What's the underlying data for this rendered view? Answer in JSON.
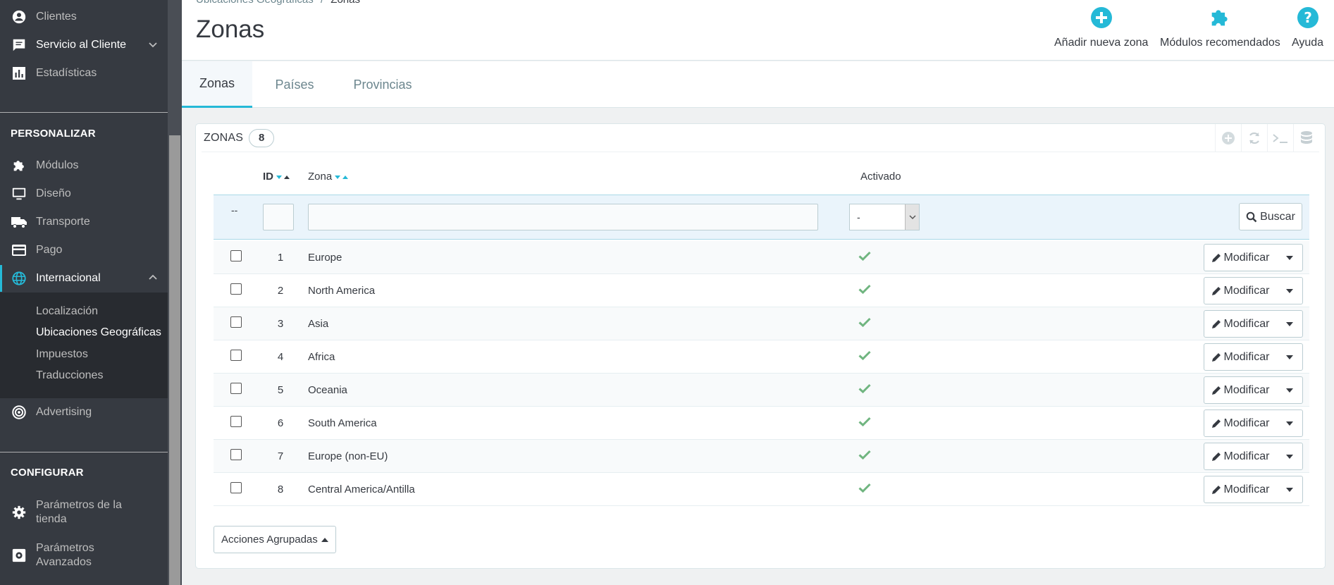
{
  "sidebar": {
    "top_items": [
      {
        "label": "Clientes",
        "icon": "user-icon"
      },
      {
        "label": "Servicio al Cliente",
        "icon": "chat-icon"
      },
      {
        "label": "Estadísticas",
        "icon": "stats-icon"
      }
    ],
    "section_personalizar": "PERSONALIZAR",
    "personalizar_items": [
      {
        "label": "Módulos",
        "icon": "puzzle-icon"
      },
      {
        "label": "Diseño",
        "icon": "monitor-icon"
      },
      {
        "label": "Transporte",
        "icon": "truck-icon"
      },
      {
        "label": "Pago",
        "icon": "card-icon"
      },
      {
        "label": "Internacional",
        "icon": "globe-icon"
      }
    ],
    "internacional_sub": [
      "Localización",
      "Ubicaciones Geográficas",
      "Impuestos",
      "Traducciones"
    ],
    "advertising": "Advertising",
    "section_configurar": "CONFIGURAR",
    "configurar_items": [
      {
        "label": "Parámetros de la tienda",
        "icon": "gear-icon"
      },
      {
        "label": "Parámetros Avanzados",
        "icon": "settings-box-icon"
      }
    ]
  },
  "header": {
    "breadcrumb_parent": "Ubicaciones Geográficas",
    "breadcrumb_sep": "/",
    "breadcrumb_current": "Zonas",
    "title": "Zonas",
    "toolbar": {
      "add_zone": "Añadir nueva zona",
      "recommended_modules": "Módulos recomendados",
      "help": "Ayuda"
    }
  },
  "tabs": [
    "Zonas",
    "Países",
    "Provincias"
  ],
  "panel": {
    "title": "ZONAS",
    "count": "8",
    "columns": {
      "id": "ID",
      "zona": "Zona",
      "activado": "Activado"
    },
    "filter": {
      "dash": "--",
      "select_value": "-",
      "search_button": "Buscar"
    },
    "rows": [
      {
        "id": "1",
        "zona": "Europe"
      },
      {
        "id": "2",
        "zona": "North America"
      },
      {
        "id": "3",
        "zona": "Asia"
      },
      {
        "id": "4",
        "zona": "Africa"
      },
      {
        "id": "5",
        "zona": "Oceania"
      },
      {
        "id": "6",
        "zona": "South America"
      },
      {
        "id": "7",
        "zona": "Europe (non-EU)"
      },
      {
        "id": "8",
        "zona": "Central America/Antilla"
      }
    ],
    "row_action": "Modificar",
    "bulk_actions": "Acciones Agrupadas"
  },
  "colors": {
    "accent": "#25b9d7",
    "success": "#70b580",
    "sidebar": "#363a41"
  }
}
